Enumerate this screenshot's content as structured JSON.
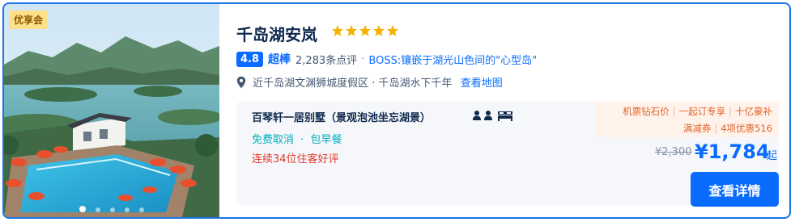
{
  "hotel": {
    "badge": "优享会",
    "name": "千岛湖安岚",
    "star_count": 5,
    "rating": {
      "score": "4.8",
      "label": "超棒",
      "reviews": "2,283条点评",
      "separator": "·",
      "highlight": "BOSS:镶嵌于湖光山色间的\"心型岛\""
    },
    "location": {
      "text": "近千岛湖文渊狮城度假区 · 千岛湖水下千年",
      "map_link": "查看地图"
    },
    "photo": {
      "slides": 5,
      "active_slide": 1
    }
  },
  "room": {
    "name": "百琴轩一居别墅（景观泡池坐忘湖景）",
    "perks": [
      "免费取消",
      "包早餐"
    ],
    "perk_separator": "·",
    "praise": "连续34位住客好评"
  },
  "promo_tags": {
    "line1": [
      "机票钻石价",
      "一起订专享",
      "十亿豪补"
    ],
    "line2": [
      "满减券",
      "4项优惠516"
    ],
    "divider": "|"
  },
  "price": {
    "original": "¥2,300",
    "current": "¥1,784",
    "suffix": "起"
  },
  "actions": {
    "detail_button": "查看详情"
  },
  "colors": {
    "accent": "#0a6cff",
    "star": "#f6b100",
    "praise": "#e33a2b",
    "perk": "#06aebd",
    "promo": "#e0642b"
  },
  "icons": [
    "star-icon",
    "map-pin-icon",
    "person-icon",
    "bed-icon"
  ]
}
